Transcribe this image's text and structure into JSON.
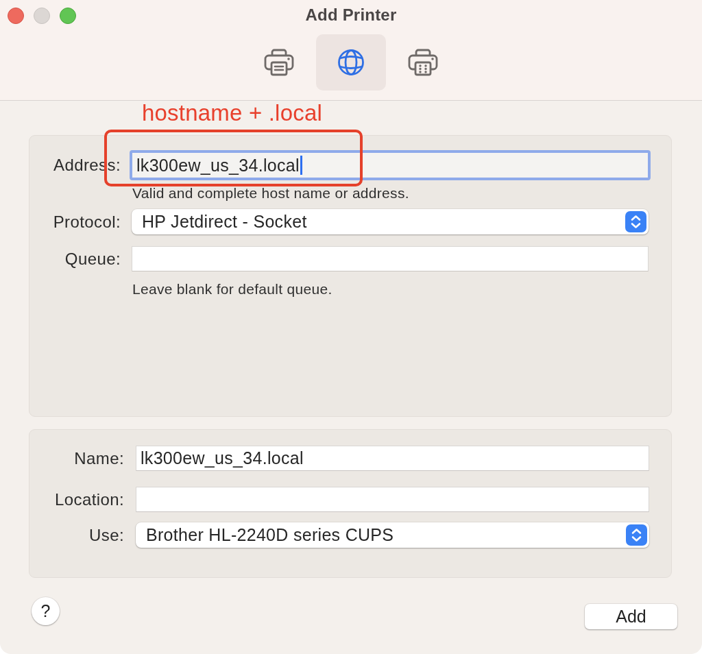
{
  "window": {
    "title": "Add Printer",
    "controls": [
      {
        "kind": "close",
        "disabled": false
      },
      {
        "kind": "minimize",
        "disabled": true
      },
      {
        "kind": "zoom",
        "disabled": false
      }
    ]
  },
  "toolbar": {
    "items": [
      {
        "kind": "printer",
        "selected": false
      },
      {
        "kind": "globe",
        "selected": true
      },
      {
        "kind": "printer-keypad",
        "selected": false
      }
    ]
  },
  "annotation": {
    "text": "hostname + .local"
  },
  "connection_panel": {
    "fields": [
      {
        "kind": "text",
        "label": "Address:",
        "value": "lk300ew_us_34.local",
        "focused": true,
        "note": "Valid and complete host name or address."
      },
      {
        "kind": "popup",
        "label": "Protocol:",
        "value": "HP Jetdirect - Socket",
        "focused": false
      },
      {
        "kind": "text",
        "label": "Queue:",
        "focused": false,
        "note": "Leave blank for default queue."
      }
    ]
  },
  "printer_panel": {
    "fields": [
      {
        "kind": "text",
        "label": "Name:",
        "value": "lk300ew_us_34.local",
        "focused": false
      },
      {
        "kind": "text",
        "label": "Location:",
        "focused": false
      },
      {
        "kind": "popup",
        "label": "Use:",
        "value": "Brother HL-2240D series CUPS",
        "focused": false
      }
    ]
  },
  "footer": {
    "help_button": "?",
    "buttons": [
      {
        "label": "Add"
      }
    ]
  }
}
